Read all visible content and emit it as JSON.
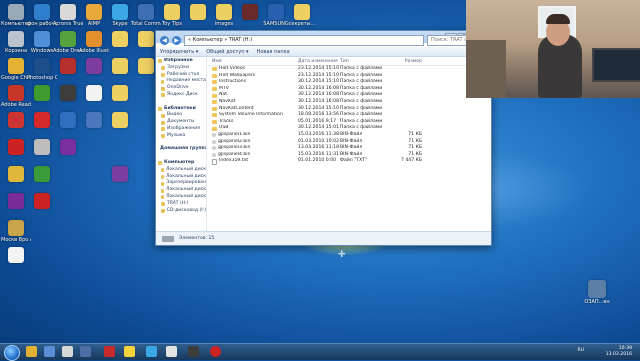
{
  "desktop_icons": [
    {
      "label": "Компьютер",
      "color": "#9aa9b8",
      "col": 0,
      "row": 0
    },
    {
      "label": "Корзина",
      "color": "#b9c4cf",
      "col": 0,
      "row": 1
    },
    {
      "label": "Google Chrome",
      "color": "#e3b233",
      "col": 0,
      "row": 2
    },
    {
      "label": "Adobe Reader XI",
      "color": "#c73528",
      "col": 0,
      "row": 3
    },
    {
      "label": "",
      "color": "#cc3333",
      "col": 0,
      "row": 4
    },
    {
      "label": "",
      "color": "#cc2222",
      "col": 0,
      "row": 5
    },
    {
      "label": "",
      "color": "#e0b73a",
      "col": 0,
      "row": 6
    },
    {
      "label": "",
      "color": "#7b2c9b",
      "col": 0,
      "row": 7
    },
    {
      "label": "Москв Вро Афон...",
      "color": "#c9a34a",
      "col": 0,
      "row": 8
    },
    {
      "label": "",
      "color": "#f3f3f3",
      "col": 0,
      "row": 9
    },
    {
      "label": "фон рабоч.png",
      "color": "#2f7fcc",
      "col": 1,
      "row": 0
    },
    {
      "label": "Windows",
      "color": "#4f8fd8",
      "col": 1,
      "row": 1
    },
    {
      "label": "Photoshop CS6",
      "color": "#1c4f8a",
      "col": 1,
      "row": 2
    },
    {
      "label": "",
      "color": "#3e9c2e",
      "col": 1,
      "row": 3
    },
    {
      "label": "",
      "color": "#d7282a",
      "col": 1,
      "row": 4
    },
    {
      "label": "",
      "color": "#bdbdbd",
      "col": 1,
      "row": 5
    },
    {
      "label": "",
      "color": "#3a9b3a",
      "col": 1,
      "row": 6
    },
    {
      "label": "",
      "color": "#cc2222",
      "col": 1,
      "row": 7
    },
    {
      "label": "Acronis True Image",
      "color": "#d9d9d9",
      "col": 2,
      "row": 0
    },
    {
      "label": "Adobe Dream.",
      "color": "#56a23f",
      "col": 2,
      "row": 1
    },
    {
      "label": "",
      "color": "#b8302d",
      "col": 2,
      "row": 2
    },
    {
      "label": "",
      "color": "#3d3d3d",
      "col": 2,
      "row": 3
    },
    {
      "label": "",
      "color": "#2f6fbf",
      "col": 2,
      "row": 4
    },
    {
      "label": "",
      "color": "#7a2fa0",
      "col": 2,
      "row": 5
    },
    {
      "label": "AIMP",
      "color": "#e9a83a",
      "col": 3,
      "row": 0
    },
    {
      "label": "Adobe Illustrator",
      "color": "#e28f2d",
      "col": 3,
      "row": 1
    },
    {
      "label": "",
      "color": "#7c3d9e",
      "col": 3,
      "row": 2
    },
    {
      "label": "",
      "color": "#f2f2f2",
      "col": 3,
      "row": 3
    },
    {
      "label": "",
      "color": "#4b77be",
      "col": 3,
      "row": 4
    },
    {
      "label": "Skype",
      "color": "#3ba7e5",
      "col": 4,
      "row": 0
    },
    {
      "label": "",
      "color": "#eecf62",
      "col": 4,
      "row": 1
    },
    {
      "label": "",
      "color": "#eecf62",
      "col": 4,
      "row": 2
    },
    {
      "label": "",
      "color": "#eecf62",
      "col": 4,
      "row": 3
    },
    {
      "label": "",
      "color": "#eecf62",
      "col": 4,
      "row": 4
    },
    {
      "label": "",
      "color": "#7a3ea2",
      "col": 4,
      "row": 6
    },
    {
      "label": "Total Commander",
      "color": "#3e6fb4",
      "col": 5,
      "row": 0
    },
    {
      "label": "",
      "color": "#eecf62",
      "col": 5,
      "row": 1
    },
    {
      "label": "",
      "color": "#eecf62",
      "col": 5,
      "row": 2
    },
    {
      "label": "Toy Tips",
      "color": "#eecf62",
      "col": 6,
      "row": 0
    },
    {
      "label": "",
      "color": "#eecf62",
      "col": 7,
      "row": 0
    },
    {
      "label": "images",
      "color": "#eecf62",
      "col": 8,
      "row": 0
    },
    {
      "label": "",
      "color": "#6a2a2a",
      "col": 9,
      "row": 0
    },
    {
      "label": "SAMSUNG",
      "color": "#2a5fb0",
      "col": 10,
      "row": 0
    },
    {
      "label": "секреты...",
      "color": "#eecf62",
      "col": 11,
      "row": 0
    }
  ],
  "explorer": {
    "address": "« Компьютер » TRAT (H:)",
    "search_placeholder": "Поиск: TRAT (H:)",
    "toolbar": [
      "Упорядочить ▾",
      "Общий доступ ▾",
      "Новая папка"
    ],
    "nav_items": [
      {
        "label": "Избранное",
        "head": true
      },
      {
        "label": "Загрузки",
        "head": false
      },
      {
        "label": "Рабочий стол",
        "head": false
      },
      {
        "label": "Недавние места",
        "head": false
      },
      {
        "label": "OneDrive",
        "head": false
      },
      {
        "label": "Яндекс.Диск",
        "head": false
      },
      {
        "label": "",
        "head": false
      },
      {
        "label": "Библиотеки",
        "head": true
      },
      {
        "label": "Видео",
        "head": false
      },
      {
        "label": "Документы",
        "head": false
      },
      {
        "label": "Изображения",
        "head": false
      },
      {
        "label": "Музыка",
        "head": false
      },
      {
        "label": "",
        "head": false
      },
      {
        "label": "Домашняя группа",
        "head": true
      },
      {
        "label": "",
        "head": false
      },
      {
        "label": "Компьютер",
        "head": true
      },
      {
        "label": "Локальный диск",
        "head": false
      },
      {
        "label": "Локальный диск",
        "head": false
      },
      {
        "label": "Зарезервирован",
        "head": false
      },
      {
        "label": "Локальный диск",
        "head": false
      },
      {
        "label": "Локальный диск",
        "head": false
      },
      {
        "label": "TRAT (H:)",
        "head": false
      },
      {
        "label": "CD-дисковод (I:)",
        "head": false
      }
    ],
    "columns": [
      "Имя",
      "Дата изменения",
      "Тип",
      "Размер"
    ],
    "files": [
      {
        "name": "Holt Videos",
        "date": "23.12.2014 15:10",
        "type": "Папка с файлами",
        "size": "",
        "kind": "folder"
      },
      {
        "name": "Holt Wallpapers",
        "date": "23.12.2014 15:10",
        "type": "Папка с файлами",
        "size": "",
        "kind": "folder"
      },
      {
        "name": "Instructions",
        "date": "30.12.2014 15:10",
        "type": "Папка с файлами",
        "size": "",
        "kind": "folder"
      },
      {
        "name": "MTV",
        "date": "30.12.2014 16:08",
        "type": "Папка с файлами",
        "size": "",
        "kind": "folder"
      },
      {
        "name": "Nat",
        "date": "30.12.2014 16:08",
        "type": "Папка с файлами",
        "size": "",
        "kind": "folder"
      },
      {
        "name": "NavKat",
        "date": "30.12.2014 16:08",
        "type": "Папка с файлами",
        "size": "",
        "kind": "folder"
      },
      {
        "name": "NavKatContent",
        "date": "30.12.2014 15:10",
        "type": "Папка с файлами",
        "size": "",
        "kind": "folder"
      },
      {
        "name": "System Volume Information",
        "date": "18.08.2016 13:56",
        "type": "Папка с файлами",
        "size": "",
        "kind": "folder"
      },
      {
        "name": "Tracks",
        "date": "05.01.2016 9:17",
        "type": "Папка с файлами",
        "size": "",
        "kind": "folder"
      },
      {
        "name": "USB",
        "date": "30.12.2014 15:01",
        "type": "Папка с файлами",
        "size": "",
        "kind": "folder"
      },
      {
        "name": "gpspanel1.bin",
        "date": "15.03.2016 11:38",
        "type": "BIN-Файл",
        "size": "71 КБ",
        "kind": "bin"
      },
      {
        "name": "gpspanel2.bin",
        "date": "01.03.2010 10:02",
        "type": "BIN-Файл",
        "size": "71 КБ",
        "kind": "bin"
      },
      {
        "name": "gpspanel3.bin",
        "date": "13.03.2016 11:18",
        "type": "BIN-Файл",
        "size": "71 КБ",
        "kind": "bin"
      },
      {
        "name": "gpspanel4.bin",
        "date": "15.03.2016 11:31",
        "type": "BIN-Файл",
        "size": "71 КБ",
        "kind": "bin"
      },
      {
        "name": "Index359.txt",
        "date": "01.01.2010 0:00",
        "type": "Файл \"TXT\"",
        "size": "7 447 КБ",
        "kind": "file"
      }
    ],
    "status": "Элементов: 15"
  },
  "right_desktop_icon": {
    "label": "ОЗАП...вн",
    "color": "#5b7fa7"
  },
  "tray": {
    "lang": "RU",
    "time": "10:39",
    "date": "13.03.2016"
  }
}
